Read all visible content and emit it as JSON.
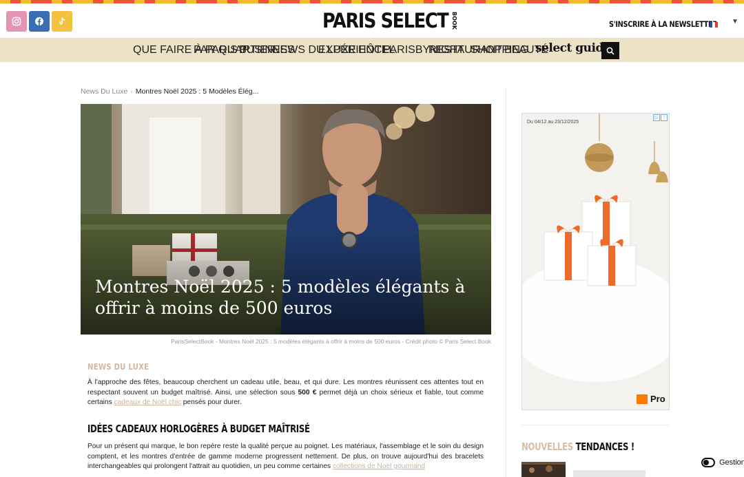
{
  "colors": {
    "nav_bg": "#ede2c5",
    "accent_beige": "#d3b9a3",
    "instagram": "#e594b6",
    "facebook": "#3b6db2",
    "tiktok": "#f3c240",
    "strip": [
      "#f1b92c",
      "#111111",
      "#e87a9c",
      "#2fa2a5",
      "#e9543b",
      "#f2d7b4",
      "#2b5ea8",
      "#111111"
    ]
  },
  "social": {
    "icons": [
      "instagram-icon",
      "facebook-icon",
      "tiktok-icon"
    ]
  },
  "header": {
    "logo_main": "PARIS SELECT",
    "logo_sub": "BOOK",
    "newsletter": "S'INSCRIRE À LA NEWSLETTER",
    "language_flag": "flag-fr-icon"
  },
  "nav": {
    "items": [
      "QUE FAIRE À PARIS ?",
      "PAR QUARTIER",
      "BUSINESS",
      "NEWS DU LUXE",
      "EXPÉRIENCE",
      "HÔTEL",
      "PARISBYNIGHT",
      "RESTAURANT",
      "SHOPPING",
      "BEAUTÉ"
    ],
    "brand": "select guide",
    "search_icon": "search-icon"
  },
  "breadcrumb": {
    "parent": "News Du Luxe",
    "separator": "›",
    "current": "Montres Noël 2025 : 5 Modèles Élég..."
  },
  "article": {
    "title": "Montres Noël 2025 : 5 modèles élégants à offrir à moins de 500 euros",
    "caption": "ParisSelectBook - Montres Noël 2025 : 5 modèles élégants à offrir à moins de 500 euros - Crédit photo © Paris Select Book",
    "category": "NEWS DU LUXE",
    "intro_p1": "À l'approche des fêtes, beaucoup cherchent un cadeau utile, beau, et qui dure. Les montres réunissent ces attentes tout en respectant souvent un budget maîtrisé. Ainsi, une sélection sous ",
    "intro_bold": "500 €",
    "intro_p2": " permet déjà un choix sérieux et fiable, tout comme certains ",
    "intro_link": "cadeaux de Noël chic",
    "intro_p3": " pensés pour durer.",
    "section_heading": "IDÉES CADEAUX HORLOGÈRES À BUDGET MAÎTRISÉ",
    "body_p1": "Pour un présent qui marque, le bon repère reste la qualité perçue au poignet. Les matériaux, l'assemblage et le soin du design comptent, et les montres d'entrée de gamme moderne progressent nettement. De plus, on trouve aujourd'hui des bracelets interchangeables qui prolongent l'attrait au quotidien, un peu comme certaines ",
    "body_link": "collections de Noël gourmand"
  },
  "ad": {
    "date_range": "Du 04/12 au 23/12/2025",
    "brand": "Pro",
    "choices_icons": [
      "ad-choices-icon",
      "ad-close-icon"
    ]
  },
  "sidebar": {
    "trends_highlight": "NOUVELLES",
    "trends_rest": " TENDANCES !"
  },
  "cookie": {
    "label": "Gestion"
  }
}
